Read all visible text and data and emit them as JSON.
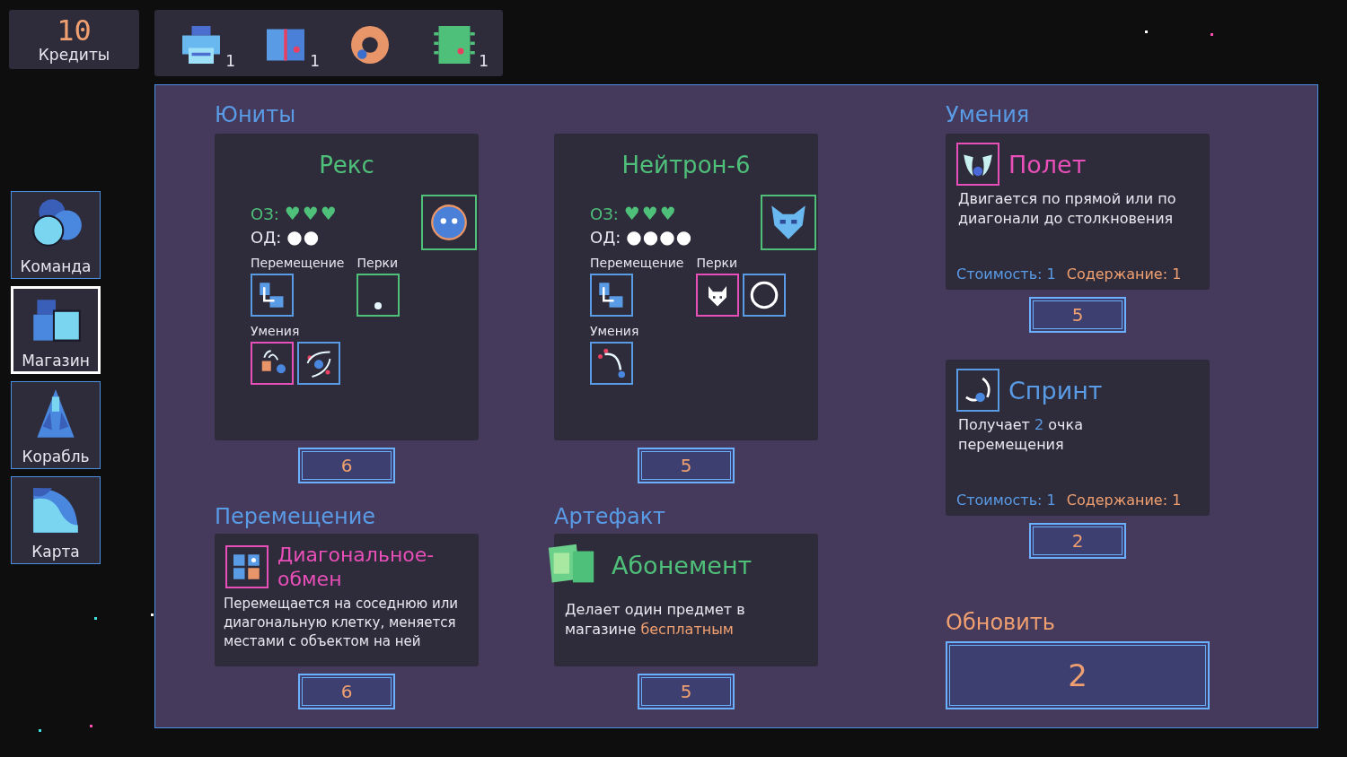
{
  "credits": {
    "value": "10",
    "label": "Кредиты"
  },
  "inventory": [
    {
      "kind": "printer",
      "count": "1"
    },
    {
      "kind": "cabinet",
      "count": "1"
    },
    {
      "kind": "donut"
    },
    {
      "kind": "chip",
      "count": "1"
    }
  ],
  "nav": [
    {
      "kind": "circles",
      "label": "Команда",
      "selected": false
    },
    {
      "kind": "crates",
      "label": "Магазин",
      "selected": true
    },
    {
      "kind": "rocket",
      "label": "Корабль",
      "selected": false
    },
    {
      "kind": "map",
      "label": "Карта",
      "selected": false
    }
  ],
  "units": {
    "title": "Юниты",
    "items": [
      {
        "name": "Рекс",
        "hp_label": "ОЗ:",
        "hp": "♥♥♥",
        "ap_label": "ОД:",
        "ap": "●●",
        "portrait": {
          "kind": "blob"
        },
        "move_label": "Перемещение",
        "moves": [
          {
            "kind": "move",
            "color": "#5a9be6"
          }
        ],
        "perks_label": "Перки",
        "perks": [
          {
            "kind": "dot",
            "color": "#4fc07a"
          }
        ],
        "abilities_label": "Умения",
        "abilities": [
          {
            "kind": "fling",
            "color": "#e84fb8"
          },
          {
            "kind": "orbit",
            "color": "#5a9be6"
          }
        ],
        "price": "6"
      },
      {
        "name": "Нейтрон-6",
        "hp_label": "ОЗ:",
        "hp": "♥♥♥",
        "ap_label": "ОД:",
        "ap": "●●●●",
        "portrait": {
          "kind": "mask"
        },
        "move_label": "Перемещение",
        "moves": [
          {
            "kind": "move",
            "color": "#5a9be6"
          }
        ],
        "perks_label": "Перки",
        "perks": [
          {
            "kind": "fox",
            "color": "#e84fb8"
          },
          {
            "kind": "ring",
            "color": "#5a9be6"
          }
        ],
        "abilities_label": "Умения",
        "abilities": [
          {
            "kind": "arc",
            "color": "#5a9be6"
          }
        ],
        "price": "5"
      }
    ]
  },
  "movement": {
    "title": "Перемещение",
    "name": "Диагональное-обмен",
    "color": "#e84fb8",
    "kind": "swap",
    "description": [
      {
        "text": "Перемещается на соседнюю или диагональную клетку, меняется местами с объектом на ней",
        "highlight": false
      }
    ],
    "price": "6"
  },
  "artifact": {
    "title": "Артефакт",
    "name": "Абонемент",
    "color": "#4fc07a",
    "kind": "ticket",
    "description": [
      {
        "text": "Делает один предмет в магазине ",
        "highlight": false
      },
      {
        "text": "бесплатным",
        "highlight": true
      }
    ],
    "price": "5"
  },
  "skills": {
    "title": "Умения",
    "items": [
      {
        "name": "Полет",
        "color": "#e84fb8",
        "kind": "wings",
        "description": [
          {
            "text": "Двигается по прямой или по диагонали до столкновения",
            "highlight": false
          }
        ],
        "cost": "Стоимость: 1",
        "upkeep": "Содержание: 1",
        "price": "5"
      },
      {
        "name": "Спринт",
        "color": "#5a9be6",
        "kind": "dash",
        "description": [
          {
            "text": "Получает ",
            "highlight": false
          },
          {
            "text": "2",
            "highlight": true
          },
          {
            "text": " очка перемещения",
            "highlight": false
          }
        ],
        "cost": "Стоимость: 1",
        "upkeep": "Содержание: 1",
        "price": "2"
      }
    ]
  },
  "refresh": {
    "title": "Обновить",
    "price": "2"
  }
}
